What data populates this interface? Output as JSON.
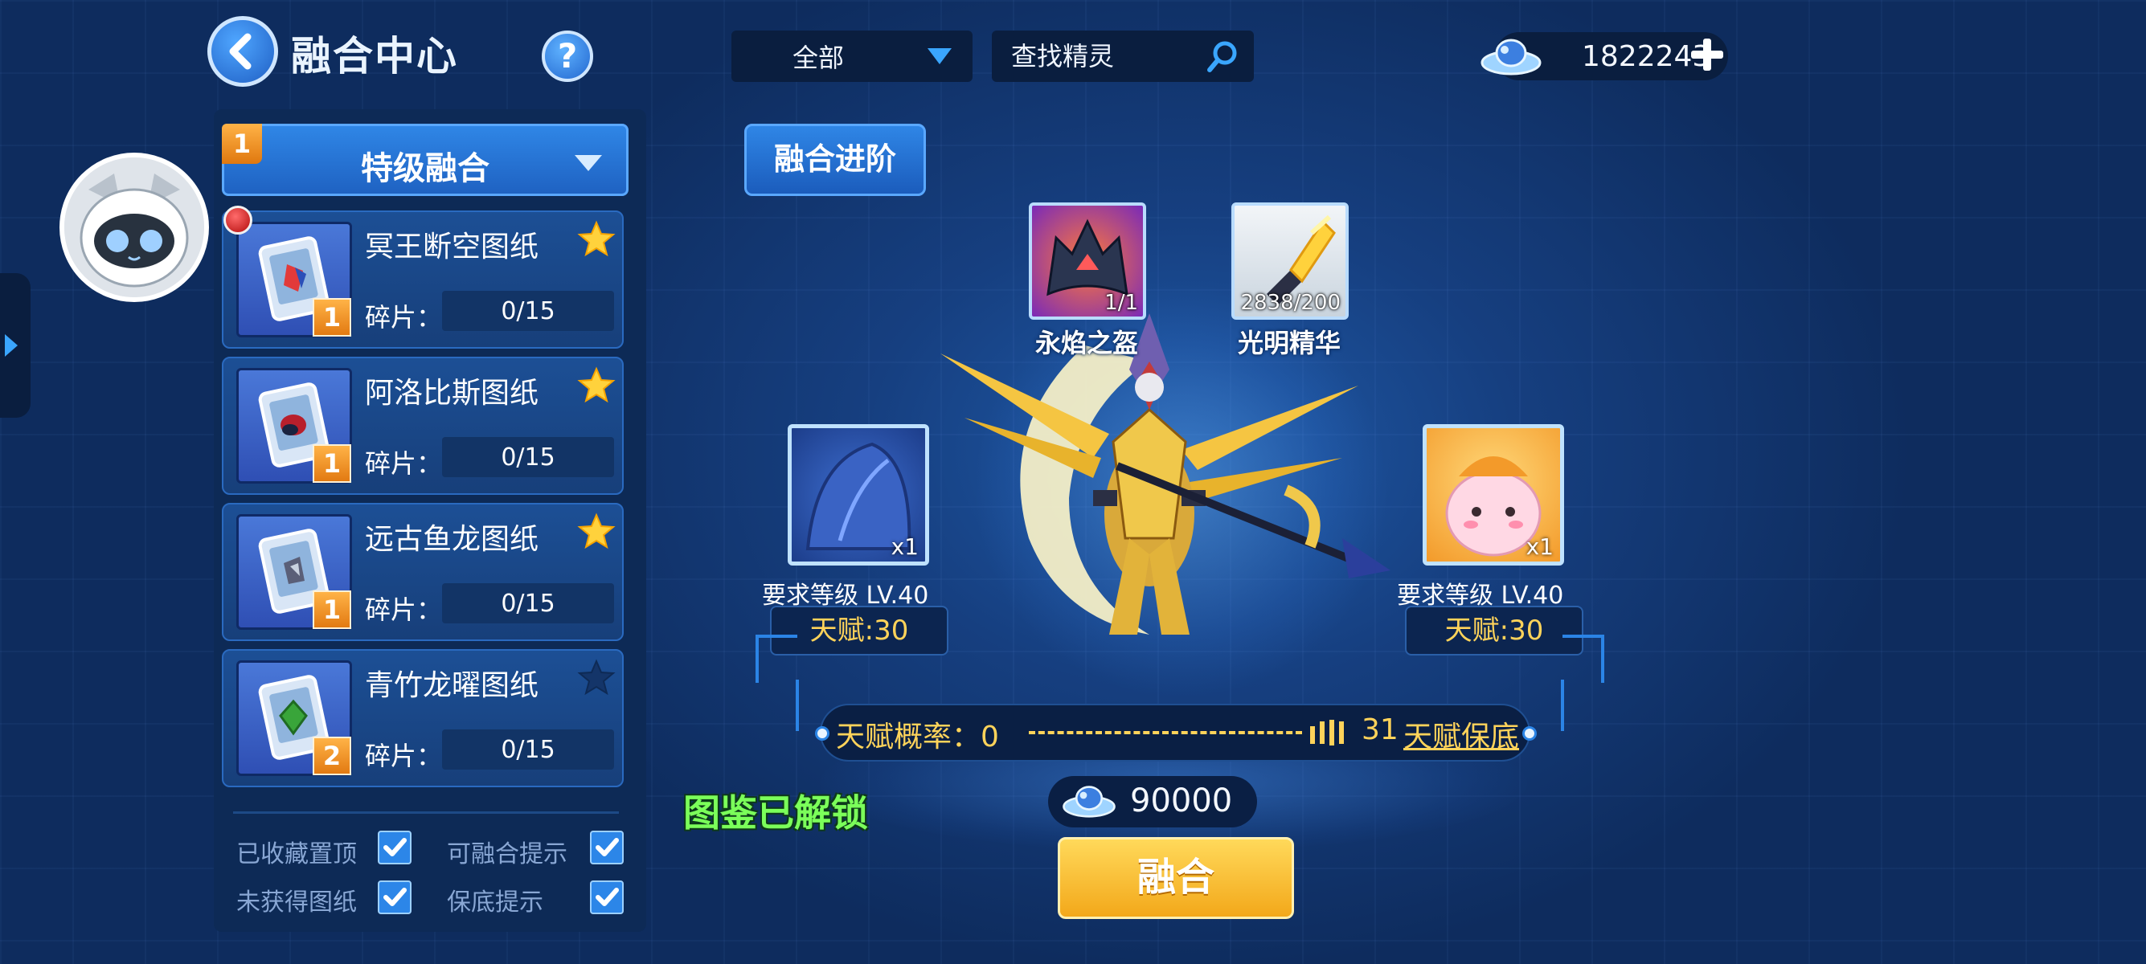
{
  "header": {
    "title": "融合中心",
    "help_label": "?",
    "filter_selected": "全部",
    "search_placeholder": "查找精灵",
    "currency_amount": "1822243"
  },
  "sidebar": {
    "category_label": "特级融合",
    "category_badge": "1",
    "items": [
      {
        "name": "冥王断空图纸",
        "fragments_label": "碎片：",
        "fragments": "0/15",
        "level": "1",
        "starred": true
      },
      {
        "name": "阿洛比斯图纸",
        "fragments_label": "碎片：",
        "fragments": "0/15",
        "level": "1",
        "starred": true
      },
      {
        "name": "远古鱼龙图纸",
        "fragments_label": "碎片：",
        "fragments": "0/15",
        "level": "1",
        "starred": true
      },
      {
        "name": "青竹龙曜图纸",
        "fragments_label": "碎片：",
        "fragments": "0/15",
        "level": "2",
        "starred": false
      }
    ],
    "options": {
      "pin_collected": "已收藏置顶",
      "fusion_hint": "可融合提示",
      "not_obtained": "未获得图纸",
      "guarantee_hint": "保底提示"
    }
  },
  "main": {
    "advance_label": "融合进阶",
    "materials": [
      {
        "name": "永焰之盔",
        "count": "1/1"
      },
      {
        "name": "光明精华",
        "count": "2838/200"
      }
    ],
    "left_parent": {
      "count": "x1",
      "requirement": "要求等级 LV.40",
      "talent": "天赋:30"
    },
    "right_parent": {
      "count": "x1",
      "requirement": "要求等级 LV.40",
      "talent": "天赋:30"
    },
    "talent_probability_label": "天赋概率：0",
    "talent_probability_max": "31",
    "talent_guarantee": "天赋保底",
    "unlocked_text": "图鉴已解锁",
    "cost": "90000",
    "fuse_label": "融合"
  },
  "colors": {
    "accent_blue": "#2f86e6",
    "gold": "#ffd35a",
    "unlocked_green": "#7bff5a",
    "badge_orange": "#e27a12"
  }
}
